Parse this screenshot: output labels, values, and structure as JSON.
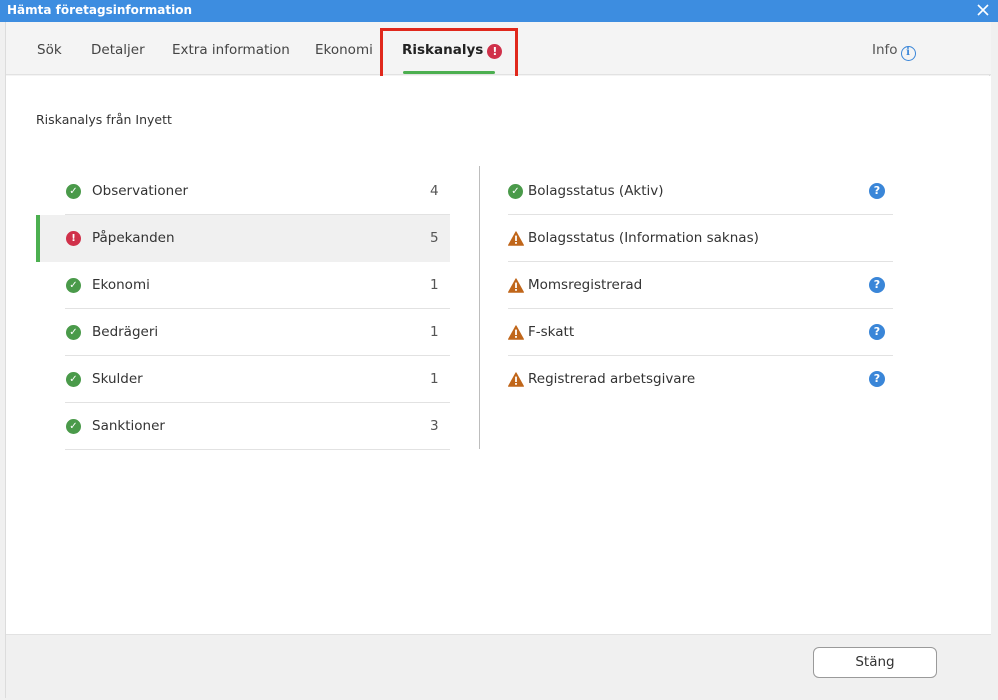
{
  "window": {
    "title": "Hämta företagsinformation",
    "close_icon": "close-icon"
  },
  "tabs": [
    {
      "label": "Sök"
    },
    {
      "label": "Detaljer"
    },
    {
      "label": "Extra information"
    },
    {
      "label": "Ekonomi"
    },
    {
      "label": "Riskanalys",
      "active": true,
      "badge": "!"
    },
    {
      "label": "Info",
      "icon": "info-icon"
    }
  ],
  "colors": {
    "titlebar": "#3d8de0",
    "accent_green": "#4caf50",
    "ok_green": "#4a9a4a",
    "error_red": "#d0314a",
    "warning_orange": "#c0661a",
    "help_blue": "#3a86d8",
    "highlight_red": "#e0281c"
  },
  "section": {
    "title": "Riskanalys från Inyett"
  },
  "categories": [
    {
      "label": "Observationer",
      "count": "4",
      "status": "ok"
    },
    {
      "label": "Påpekanden",
      "count": "5",
      "status": "error",
      "selected": true
    },
    {
      "label": "Ekonomi",
      "count": "1",
      "status": "ok"
    },
    {
      "label": "Bedrägeri",
      "count": "1",
      "status": "ok"
    },
    {
      "label": "Skulder",
      "count": "1",
      "status": "ok"
    },
    {
      "label": "Sanktioner",
      "count": "3",
      "status": "ok"
    }
  ],
  "details": [
    {
      "label": "Bolagsstatus (Aktiv)",
      "status": "ok",
      "help": "?"
    },
    {
      "label": "Bolagsstatus (Information saknas)",
      "status": "warning"
    },
    {
      "label": "Momsregistrerad",
      "status": "warning",
      "help": "?"
    },
    {
      "label": "F-skatt",
      "status": "warning",
      "help": "?"
    },
    {
      "label": "Registrerad arbetsgivare",
      "status": "warning",
      "help": "?"
    }
  ],
  "icon_glyphs": {
    "ok": "✓",
    "error": "!"
  },
  "footer": {
    "close_label": "Stäng"
  }
}
